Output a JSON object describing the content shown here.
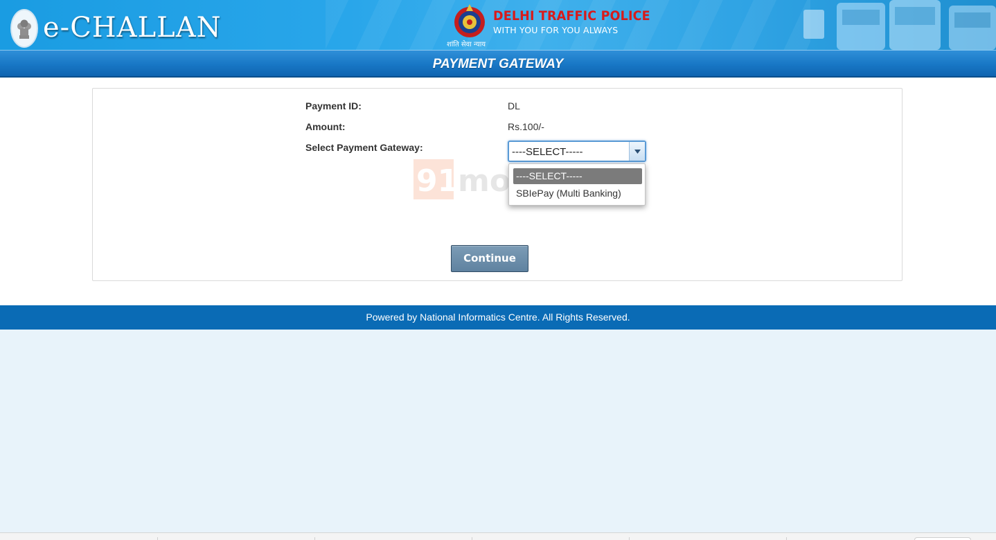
{
  "header": {
    "brand": "e-CHALLAN",
    "org_title": "DELHI TRAFFIC POLICE",
    "org_tagline": "WITH YOU FOR YOU ALWAYS",
    "org_motto": "शांति सेवा न्याय",
    "emblem_icon": "national-emblem-icon",
    "police_badge_icon": "police-badge-icon"
  },
  "title_bar": {
    "title": "PAYMENT GATEWAY"
  },
  "form": {
    "payment_id_label": "Payment ID:",
    "payment_id_value": "DL",
    "amount_label": "Amount:",
    "amount_value": "Rs.100/-",
    "gateway_label": "Select Payment Gateway:",
    "gateway_selected": "----SELECT-----",
    "gateway_options": [
      "----SELECT-----",
      "SBIePay (Multi Banking)"
    ]
  },
  "watermark": {
    "number": "91",
    "text": "mobiles"
  },
  "actions": {
    "continue_label": "Continue"
  },
  "footer": {
    "text": "Powered by National Informatics Centre. All Rights Reserved."
  },
  "colors": {
    "header_blue": "#1a9ce2",
    "title_bar_blue": "#1877c5",
    "footer_blue": "#0a6bb5",
    "page_bg": "#e8f3fa",
    "brand_red": "#d81b1b",
    "button_slate": "#6a8ca9"
  }
}
